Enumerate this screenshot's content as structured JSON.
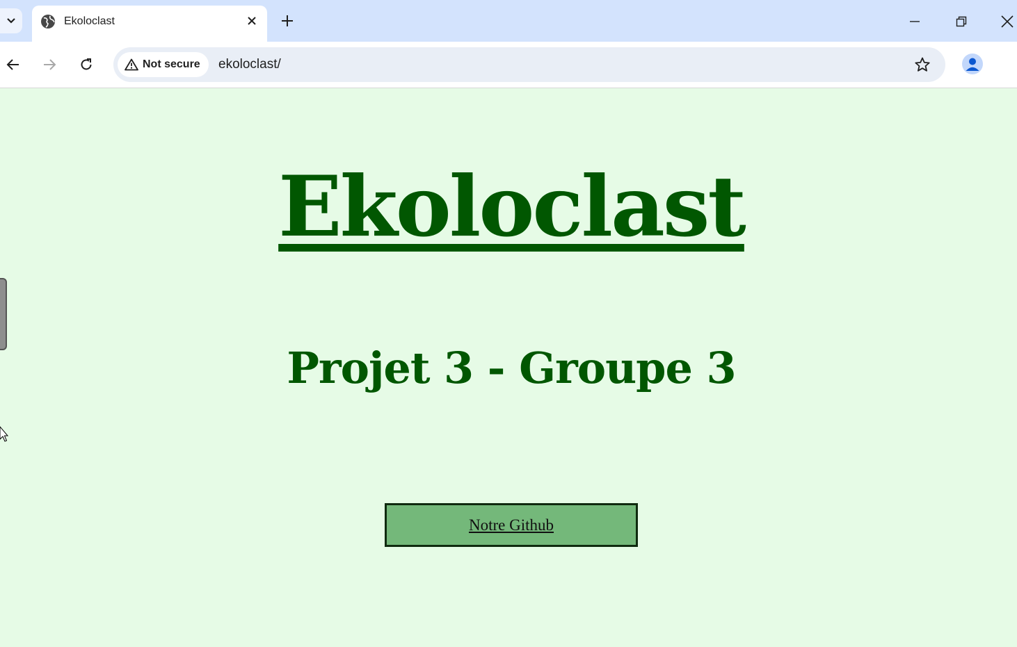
{
  "browser": {
    "tab_title": "Ekoloclast",
    "security_label": "Not secure",
    "url": "ekoloclast/"
  },
  "page": {
    "title": "Ekoloclast",
    "subtitle": "Projet 3 - Groupe 3",
    "github_button_label": "Notre Github"
  },
  "colors": {
    "page_background": "#e6fbe6",
    "heading_green": "#015701",
    "button_fill": "#74b87a"
  },
  "icons": {
    "tab_search": "chevron-down-icon",
    "favicon": "globe-icon",
    "tab_close": "close-icon",
    "new_tab": "plus-icon",
    "back": "arrow-left-icon",
    "forward": "arrow-right-icon",
    "reload": "reload-icon",
    "security": "warning-triangle-icon",
    "bookmark": "star-icon",
    "profile": "person-icon",
    "menu": "kebab-menu-icon"
  }
}
